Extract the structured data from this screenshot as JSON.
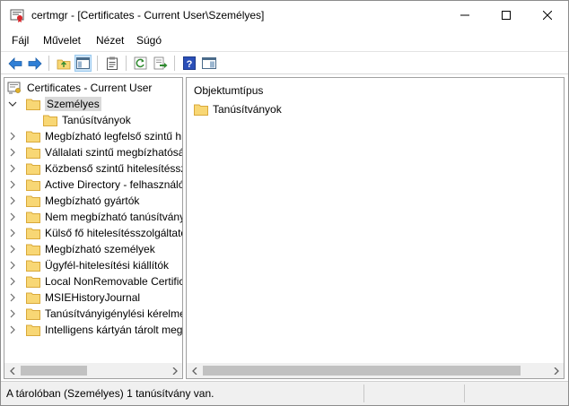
{
  "window": {
    "title": "certmgr - [Certificates - Current User\\Személyes]",
    "icon": "certificate-manager-icon",
    "controls": [
      "minimize-icon",
      "maximize-icon",
      "close-icon"
    ]
  },
  "menu": {
    "items": [
      "Fájl",
      "Művelet",
      "Nézet",
      "Súgó"
    ]
  },
  "toolbar": {
    "buttons": [
      {
        "name": "back-button",
        "icon": "arrow-left-icon"
      },
      {
        "name": "forward-button",
        "icon": "arrow-right-icon"
      },
      {
        "name": "up-folder-button",
        "icon": "folder-up-icon"
      },
      {
        "name": "show-console-tree-button",
        "icon": "console-tree-icon",
        "pressed": true
      },
      {
        "name": "properties-button",
        "icon": "clipboard-icon"
      },
      {
        "name": "refresh-button",
        "icon": "refresh-icon"
      },
      {
        "name": "export-list-button",
        "icon": "export-icon"
      },
      {
        "name": "help-button",
        "icon": "help-icon"
      },
      {
        "name": "show-action-pane-button",
        "icon": "action-pane-icon"
      }
    ]
  },
  "tree": {
    "root": "Certificates - Current User",
    "selected": "Személyes",
    "child": "Tanúsítványok",
    "items": [
      "Megbízható legfelső szintű hi",
      "Vállalati szintű megbízhatóság",
      "Közbenső szintű hitelesítésszo",
      "Active Directory - felhasználó",
      "Megbízható gyártók",
      "Nem megbízható tanúsítvány",
      "Külső fő hitelesítésszolgáltató",
      "Megbízható személyek",
      "Ügyfél-hitelesítési kiállítók",
      "Local NonRemovable Certific",
      "MSIEHistoryJournal",
      "Tanúsítványigénylési kérelme",
      "Intelligens kártyán tárolt meg"
    ]
  },
  "list": {
    "column_header": "Objektumtípus",
    "rows": [
      "Tanúsítványok"
    ]
  },
  "status": {
    "text": "A tárolóban (Személyes) 1 tanúsítvány van."
  },
  "colors": {
    "accent": "#0078d7",
    "folder": "#f8d775",
    "folder_dark": "#d9a93a",
    "selection": "#d9d9d9"
  }
}
